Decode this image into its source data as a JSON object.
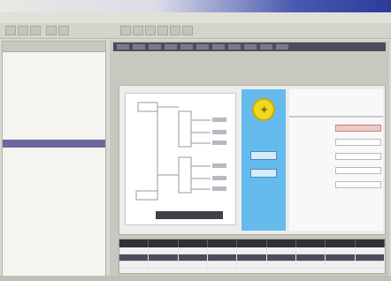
{
  "window": {
    "title": ""
  },
  "menu": {
    "items": [
      "",
      "",
      "",
      "",
      ""
    ]
  },
  "sidebar": {
    "header": "",
    "items": [
      {
        "label": "",
        "indent": false,
        "selected": false
      },
      {
        "label": "",
        "indent": true,
        "selected": false
      },
      {
        "label": "",
        "indent": true,
        "selected": false
      },
      {
        "label": "",
        "indent": false,
        "selected": false
      },
      {
        "label": "",
        "indent": true,
        "selected": false
      },
      {
        "label": "",
        "indent": true,
        "selected": false
      },
      {
        "label": "",
        "indent": false,
        "selected": false
      },
      {
        "label": "",
        "indent": false,
        "selected": false
      },
      {
        "label": "",
        "indent": true,
        "selected": false
      },
      {
        "label": "",
        "indent": false,
        "selected": false
      },
      {
        "label": "",
        "indent": false,
        "selected": false
      },
      {
        "label": "",
        "indent": false,
        "selected": true
      },
      {
        "label": "",
        "indent": false,
        "selected": false
      },
      {
        "label": "",
        "indent": true,
        "selected": false
      },
      {
        "label": "",
        "indent": true,
        "selected": false
      },
      {
        "label": "",
        "indent": true,
        "selected": false
      },
      {
        "label": "",
        "indent": false,
        "selected": false
      },
      {
        "label": "",
        "indent": true,
        "selected": false
      },
      {
        "label": "",
        "indent": true,
        "selected": false
      },
      {
        "label": "",
        "indent": false,
        "selected": false
      }
    ]
  },
  "main": {
    "subtab_left": "",
    "subtab_right": ""
  },
  "document": {
    "logo_icon": "sun-badge-icon",
    "form_title": "",
    "blue_buttons": [
      "",
      ""
    ],
    "form_rows": [
      "",
      "",
      "",
      "",
      ""
    ]
  },
  "grid": {
    "columns": [
      "",
      "",
      "",
      "",
      "",
      "",
      "",
      "",
      ""
    ],
    "rows": [
      {
        "highlighted": false
      },
      {
        "highlighted": true
      },
      {
        "highlighted": false
      }
    ]
  },
  "colors": {
    "accent_blue": "#66bbee",
    "logo_yellow": "#f0d820",
    "selection": "#6a6aa0",
    "titlebar_dark": "#2c3a9a"
  }
}
